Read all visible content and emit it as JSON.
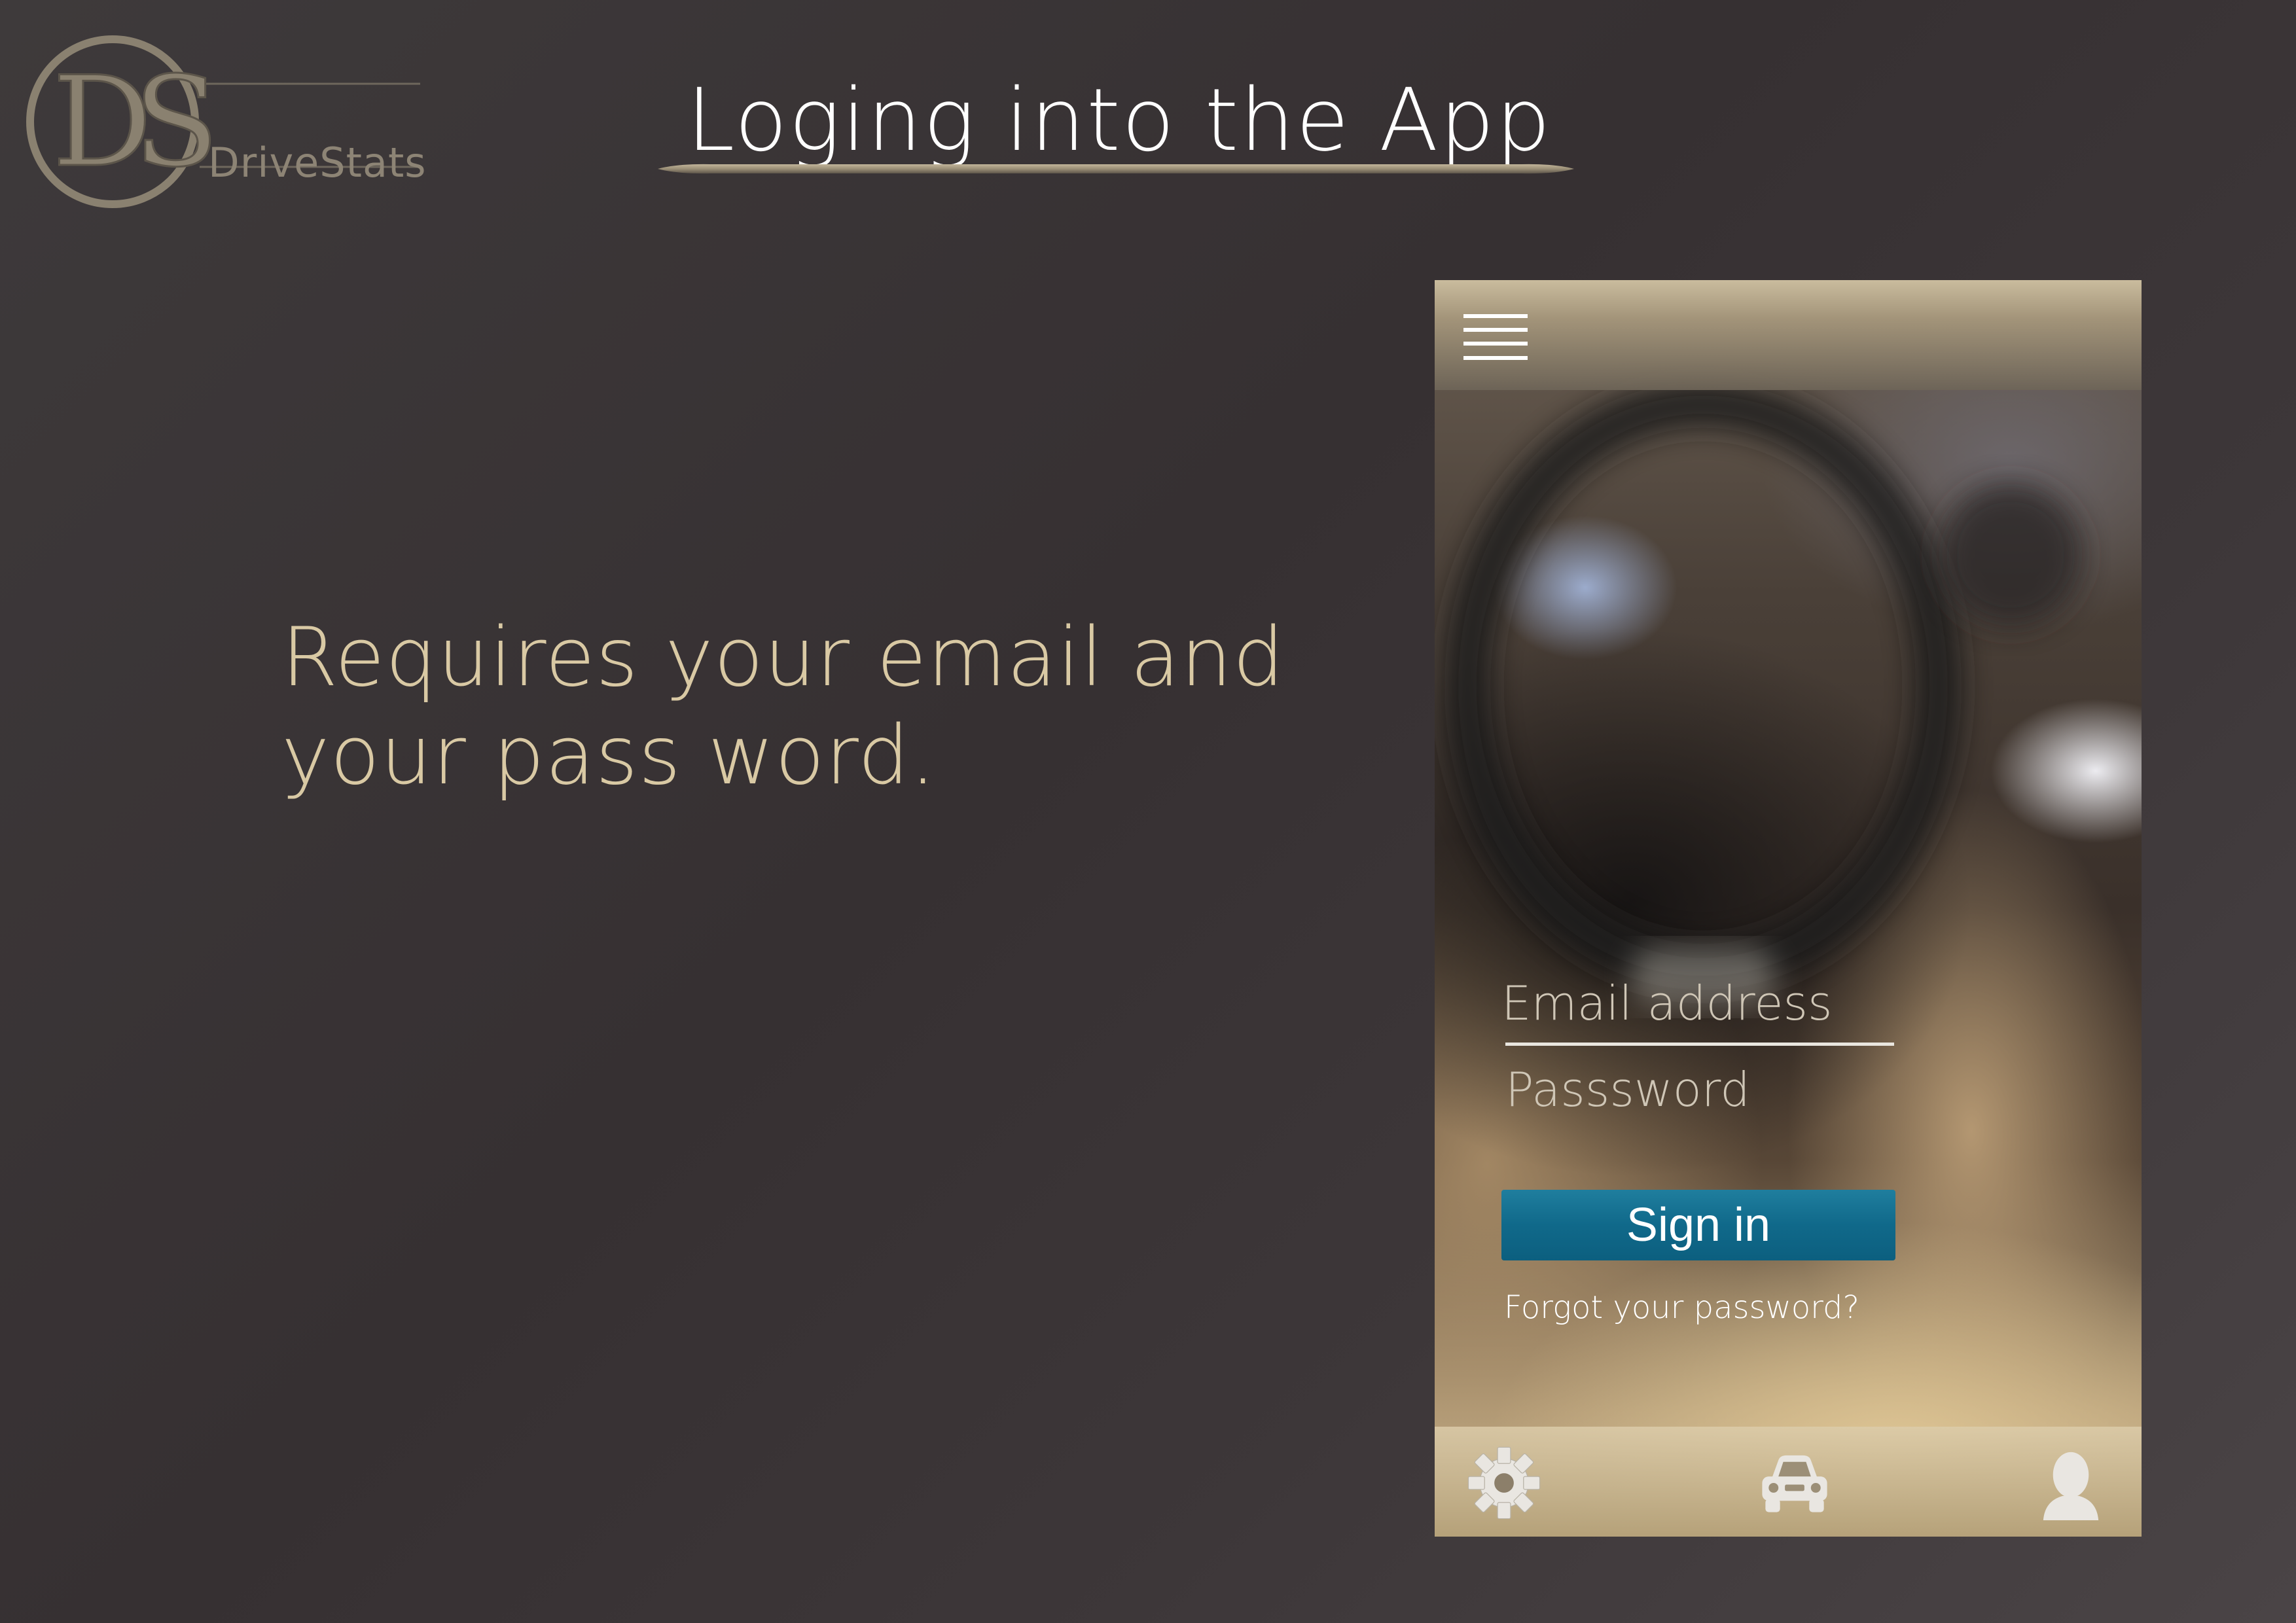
{
  "brand": {
    "monogram": "DS",
    "name": "DriveStats"
  },
  "slide": {
    "title": "Loging into the App",
    "description": "Requires your email and your pass word."
  },
  "login": {
    "email_placeholder": "Email address",
    "password_placeholder": "Passsword",
    "signin_label": "Sign in",
    "forgot_label": "Forgot your password?"
  },
  "icons": {
    "menu": "menu-icon",
    "settings": "gear-icon",
    "car": "car-icon",
    "profile": "user-icon"
  },
  "colors": {
    "accent_text": "#d9c9a4",
    "button": "#10698a",
    "background": "#3a3436"
  }
}
